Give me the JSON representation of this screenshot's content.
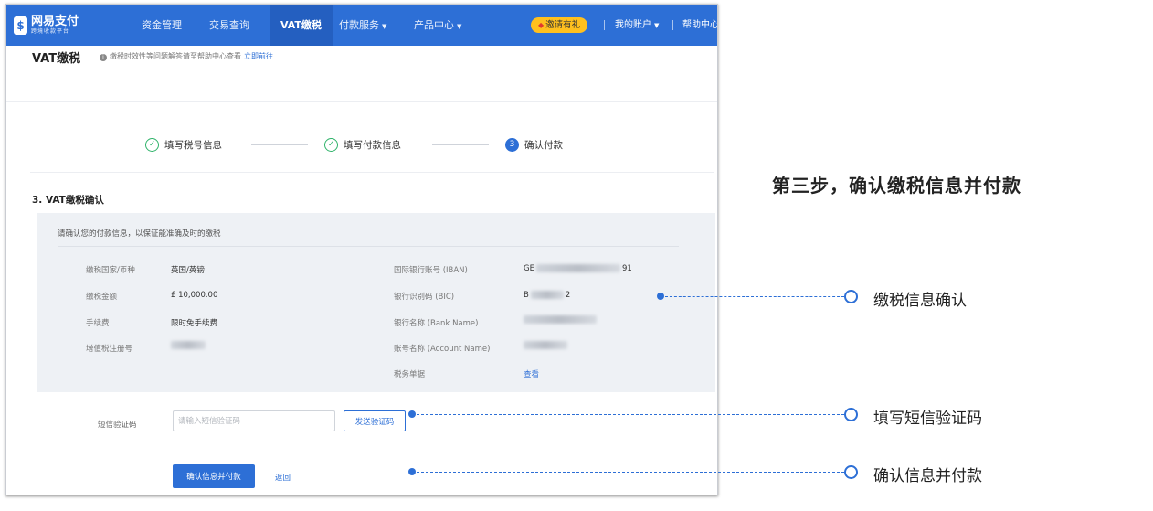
{
  "colors": {
    "brand": "#2d6fd6",
    "success": "#2fb36a",
    "invite": "#ffc01e",
    "panel": "#eef1f5"
  },
  "nav": {
    "logo_icon": "wallet-logo-icon",
    "logo_name": "网易支付",
    "logo_sub": "跨境收款平台",
    "items": [
      "资金管理",
      "交易查询",
      "VAT缴税",
      "付款服务",
      "产品中心"
    ],
    "active_item": "VAT缴税",
    "invite": "邀请有礼",
    "account": "我的账户",
    "help": "帮助中心"
  },
  "page": {
    "title": "VAT缴税",
    "tip": "缴税时效性等问题解答请至帮助中心查看",
    "tip_link": "立即前往"
  },
  "steps": [
    {
      "label": "填写税号信息",
      "status": "done"
    },
    {
      "label": "填写付款信息",
      "status": "done"
    },
    {
      "number": "3",
      "label": "确认付款",
      "status": "current"
    }
  ],
  "confirm": {
    "section_title": "3. VAT缴税确认",
    "note": "请确认您的付款信息，以保证能准确及时的缴税",
    "left": [
      {
        "label": "缴税国家/币种",
        "value": "英国/英镑"
      },
      {
        "label": "缴税金额",
        "value": "£ 10,000.00"
      },
      {
        "label": "手续费",
        "value": "限时免手续费"
      },
      {
        "label": "增值税注册号",
        "value": ""
      }
    ],
    "right": [
      {
        "label": "国际银行账号 (IBAN)",
        "value_start": "GE",
        "value_end": "91"
      },
      {
        "label": "银行识别码 (BIC)",
        "value_start": "B",
        "value_end": "2"
      },
      {
        "label": "银行名称 (Bank Name)",
        "value_start": "",
        "value_end": ""
      },
      {
        "label": "账号名称 (Account Name)",
        "value_start": "",
        "value_end": ""
      },
      {
        "label": "税务单据",
        "value": "查看"
      }
    ]
  },
  "sms": {
    "label": "短信验证码",
    "placeholder": "请输入短信验证码",
    "value": "",
    "send_button": "发送验证码"
  },
  "actions": {
    "confirm_button": "确认信息并付款",
    "back_link": "返回"
  },
  "callouts": {
    "title": "第三步，确认缴税信息并付款",
    "items": [
      "缴税信息确认",
      "填写短信验证码",
      "确认信息并付款"
    ]
  }
}
